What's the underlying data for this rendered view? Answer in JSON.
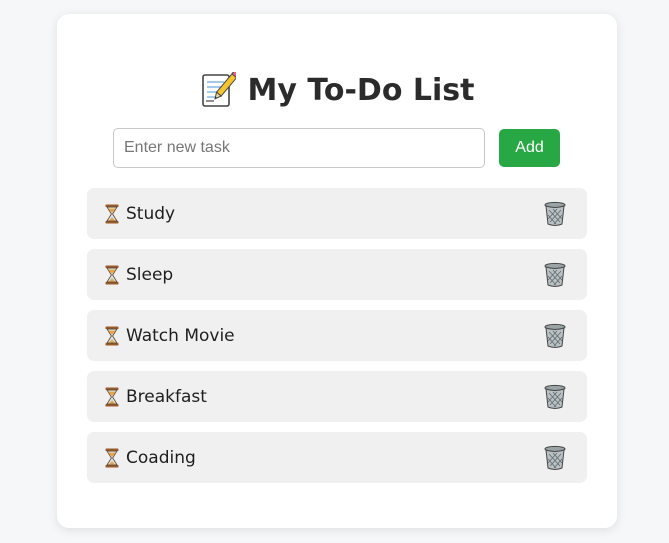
{
  "app": {
    "title": "My To-Do List",
    "title_icon": "memo-icon"
  },
  "new_task": {
    "value": "",
    "placeholder": "Enter new task",
    "add_label": "Add"
  },
  "colors": {
    "accent": "#28a745",
    "item_background": "#f0f0f0",
    "title_text": "#2b2b2b"
  },
  "tasks": [
    {
      "label": "Study",
      "status_icon": "hourglass-icon",
      "action_icon": "trash-icon"
    },
    {
      "label": "Sleep",
      "status_icon": "hourglass-icon",
      "action_icon": "trash-icon"
    },
    {
      "label": "Watch Movie",
      "status_icon": "hourglass-icon",
      "action_icon": "trash-icon"
    },
    {
      "label": "Breakfast",
      "status_icon": "hourglass-icon",
      "action_icon": "trash-icon"
    },
    {
      "label": "Coading",
      "status_icon": "hourglass-icon",
      "action_icon": "trash-icon"
    }
  ]
}
